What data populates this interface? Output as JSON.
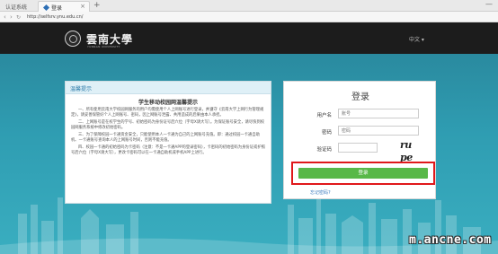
{
  "browser": {
    "inactive_tab": "认证系统",
    "active_tab": "登录",
    "close_glyph": "×",
    "new_tab_glyph": "+",
    "minimize_glyph": "—",
    "url": "http://selfsrv.ynu.edu.cn/"
  },
  "header": {
    "logo_name": "雲南大學",
    "logo_subtitle": "YUNNAN UNIVERSITY",
    "language": "中文 ▾"
  },
  "notice": {
    "heading": "温馨提示",
    "title": "学生移动校园网温馨提示",
    "paragraphs": [
      "一、所有使用云南大学校园网服务的用户均需使用个人上网账号进行登录，并遵守《云南大学上网行为管理规定》，请妥善保管好个人上网账号、密码，因上网账号泄露、共用造成的后果由本人承担。",
      "二、上网账号是在校学生的学号、初始密码为身份证号后六位（字母X请大写）。为保证账号安全，请尽快到校园网服务系统中修改初始密码。",
      "三、为了保障校园一卡通资金安全，只能使用本人一卡通为自己的上网账号充值。即：通过校园一卡通自助机、一卡通账号查询本人的上网账号时间，否则不能充值。",
      "四、校园一卡通的初始密码为卡密码（注意：不是一卡通APP的登录密码），卡密码的初始密码为身份证或护照号后六位（字母X请大写），更改卡密码可以在一卡通自助机或手机APP上进行。"
    ]
  },
  "login": {
    "title": "登录",
    "username_label": "用户名",
    "username_placeholder": "账号",
    "password_label": "密码",
    "password_placeholder": "密码",
    "captcha_label": "验证码",
    "captcha_placeholder": "",
    "captcha_text": "ru pe",
    "submit_label": "登录",
    "forgot_label": "忘记密码?"
  },
  "watermark": "m.ancne.com",
  "colors": {
    "header_bg": "#1c1c1c",
    "main_bg": "#2f9db2",
    "login_button": "#58b848",
    "highlight": "#e0181b",
    "link": "#3b7bbf"
  }
}
